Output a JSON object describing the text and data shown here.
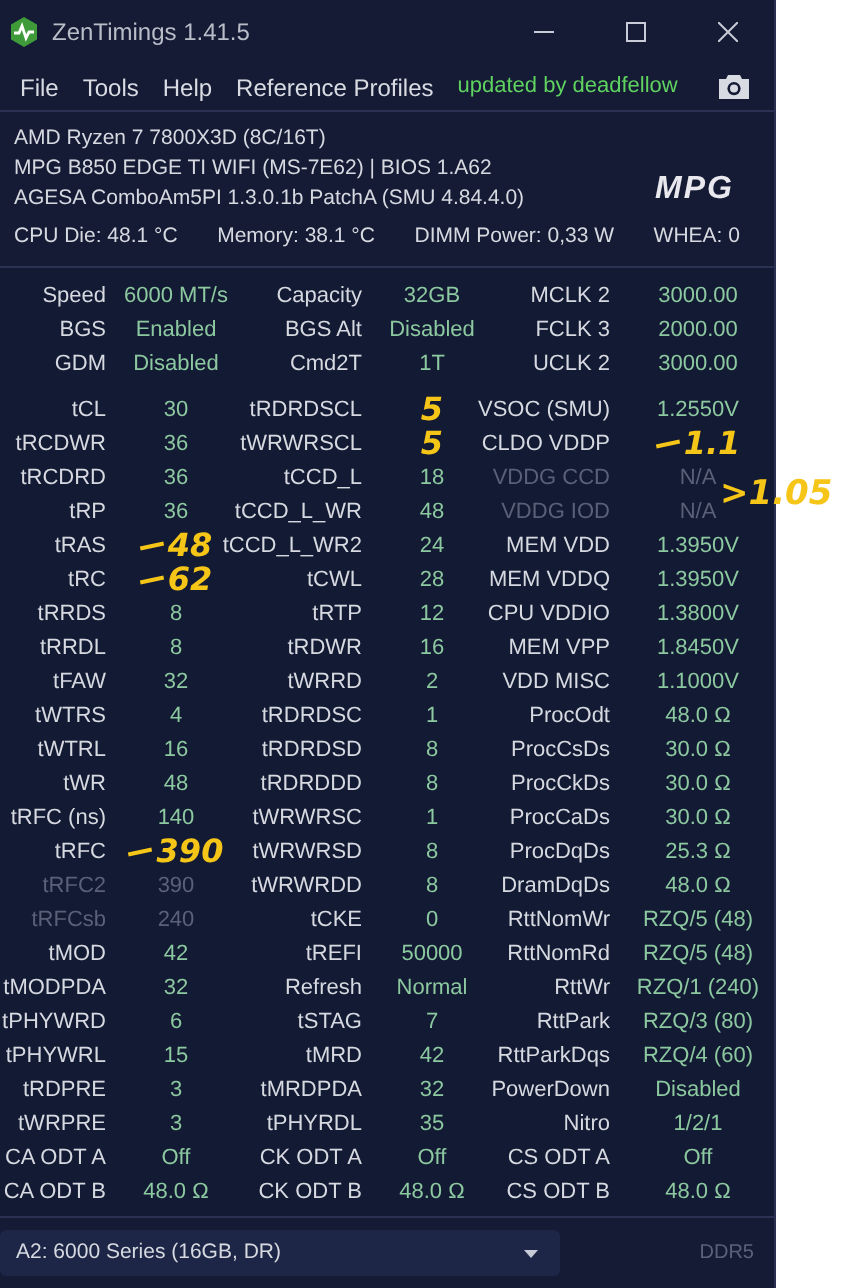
{
  "window": {
    "title": "ZenTimings 1.41.5"
  },
  "menu": [
    "File",
    "Tools",
    "Help",
    "Reference Profiles"
  ],
  "update_notice": "updated by deadfellow",
  "system": [
    "AMD Ryzen 7 7800X3D (8C/16T)",
    "MPG B850 EDGE TI WIFI (MS-7E62) | BIOS 1.A62",
    "AGESA ComboAm5PI 1.3.0.1b PatchA (SMU 4.84.4.0)"
  ],
  "logo": "MPG",
  "sensors": [
    "CPU Die: 48.1 °C",
    "Memory: 38.1 °C",
    "DIMM Power: 0,33 W",
    "WHEA: 0"
  ],
  "summary": [
    [
      {
        "label": "Speed",
        "value": "6000 MT/s"
      },
      {
        "label": "Capacity",
        "value": "32GB"
      },
      {
        "label": "MCLK  2",
        "value": "3000.00"
      }
    ],
    [
      {
        "label": "BGS",
        "value": "Enabled"
      },
      {
        "label": "BGS Alt",
        "value": "Disabled"
      },
      {
        "label": "FCLK  3",
        "value": "2000.00"
      }
    ],
    [
      {
        "label": "GDM",
        "value": "Disabled"
      },
      {
        "label": "Cmd2T",
        "value": "1T"
      },
      {
        "label": "UCLK  2",
        "value": "3000.00"
      }
    ]
  ],
  "timings": [
    [
      {
        "label": "tCL",
        "value": "30"
      },
      {
        "label": "tRDRDSCL",
        "note": "5"
      },
      {
        "label": "VSOC (SMU)",
        "value": "1.2550V"
      }
    ],
    [
      {
        "label": "tRCDWR",
        "value": "36"
      },
      {
        "label": "tWRWRSCL",
        "note": "5"
      },
      {
        "label": "CLDO VDDP",
        "struck": true,
        "note": "1.1"
      }
    ],
    [
      {
        "label": "tRCDRD",
        "value": "36"
      },
      {
        "label": "tCCD_L",
        "value": "18"
      },
      {
        "label": "VDDG CCD",
        "value": "N/A",
        "dimmed": true,
        "note": ">1.05"
      }
    ],
    [
      {
        "label": "tRP",
        "value": "36"
      },
      {
        "label": "tCCD_L_WR",
        "value": "48"
      },
      {
        "label": "VDDG IOD",
        "value": "N/A",
        "dimmed": true
      }
    ],
    [
      {
        "label": "tRAS",
        "struck": true,
        "note": "48"
      },
      {
        "label": "tCCD_L_WR2",
        "value": "24"
      },
      {
        "label": "MEM VDD",
        "value": "1.3950V"
      }
    ],
    [
      {
        "label": "tRC",
        "struck": true,
        "note": "62"
      },
      {
        "label": "tCWL",
        "value": "28"
      },
      {
        "label": "MEM VDDQ",
        "value": "1.3950V"
      }
    ],
    [
      {
        "label": "tRRDS",
        "value": "8"
      },
      {
        "label": "tRTP",
        "value": "12"
      },
      {
        "label": "CPU VDDIO",
        "value": "1.3800V"
      }
    ],
    [
      {
        "label": "tRRDL",
        "value": "8"
      },
      {
        "label": "tRDWR",
        "value": "16"
      },
      {
        "label": "MEM VPP",
        "value": "1.8450V"
      }
    ],
    [
      {
        "label": "tFAW",
        "value": "32"
      },
      {
        "label": "tWRRD",
        "value": "2"
      },
      {
        "label": "VDD MISC",
        "value": "1.1000V"
      }
    ],
    [
      {
        "label": "tWTRS",
        "value": "4"
      },
      {
        "label": "tRDRDSC",
        "value": "1"
      },
      {
        "label": "ProcOdt",
        "value": "48.0 Ω"
      }
    ],
    [
      {
        "label": "tWTRL",
        "value": "16"
      },
      {
        "label": "tRDRDSD",
        "value": "8"
      },
      {
        "label": "ProcCsDs",
        "value": "30.0 Ω"
      }
    ],
    [
      {
        "label": "tWR",
        "value": "48"
      },
      {
        "label": "tRDRDDD",
        "value": "8"
      },
      {
        "label": "ProcCkDs",
        "value": "30.0 Ω"
      }
    ],
    [
      {
        "label": "tRFC (ns)",
        "value": "140"
      },
      {
        "label": "tWRWRSC",
        "value": "1"
      },
      {
        "label": "ProcCaDs",
        "value": "30.0 Ω"
      }
    ],
    [
      {
        "label": "tRFC",
        "struck": true,
        "note": "390"
      },
      {
        "label": "tWRWRSD",
        "value": "8"
      },
      {
        "label": "ProcDqDs",
        "value": "25.3 Ω"
      }
    ],
    [
      {
        "label": "tRFC2",
        "value": "390",
        "dimmed": true
      },
      {
        "label": "tWRWRDD",
        "value": "8"
      },
      {
        "label": "DramDqDs",
        "value": "48.0 Ω"
      }
    ],
    [
      {
        "label": "tRFCsb",
        "value": "240",
        "dimmed": true
      },
      {
        "label": "tCKE",
        "value": "0"
      },
      {
        "label": "RttNomWr",
        "value": "RZQ/5 (48)"
      }
    ],
    [
      {
        "label": "tMOD",
        "value": "42"
      },
      {
        "label": "tREFI",
        "value": "50000"
      },
      {
        "label": "RttNomRd",
        "value": "RZQ/5 (48)"
      }
    ],
    [
      {
        "label": "tMODPDA",
        "value": "32"
      },
      {
        "label": "Refresh",
        "value": "Normal"
      },
      {
        "label": "RttWr",
        "value": "RZQ/1 (240)"
      }
    ],
    [
      {
        "label": "tPHYWRD",
        "value": "6"
      },
      {
        "label": "tSTAG",
        "value": "7"
      },
      {
        "label": "RttPark",
        "value": "RZQ/3 (80)"
      }
    ],
    [
      {
        "label": "tPHYWRL",
        "value": "15"
      },
      {
        "label": "tMRD",
        "value": "42"
      },
      {
        "label": "RttParkDqs",
        "value": "RZQ/4 (60)"
      }
    ],
    [
      {
        "label": "tRDPRE",
        "value": "3"
      },
      {
        "label": "tMRDPDA",
        "value": "32"
      },
      {
        "label": "PowerDown",
        "value": "Disabled"
      }
    ],
    [
      {
        "label": "tWRPRE",
        "value": "3"
      },
      {
        "label": "tPHYRDL",
        "value": "35"
      },
      {
        "label": "Nitro",
        "value": "1/2/1"
      }
    ],
    [
      {
        "label": "CA ODT A",
        "value": "Off"
      },
      {
        "label": "CK ODT A",
        "value": "Off"
      },
      {
        "label": "CS ODT A",
        "value": "Off"
      }
    ],
    [
      {
        "label": "CA ODT B",
        "value": "48.0 Ω"
      },
      {
        "label": "CK ODT B",
        "value": "48.0 Ω"
      },
      {
        "label": "CS ODT B",
        "value": "48.0 Ω"
      }
    ]
  ],
  "module_select": {
    "value": "A2: 6000 Series (16GB, DR)"
  },
  "memory_type": "DDR5"
}
